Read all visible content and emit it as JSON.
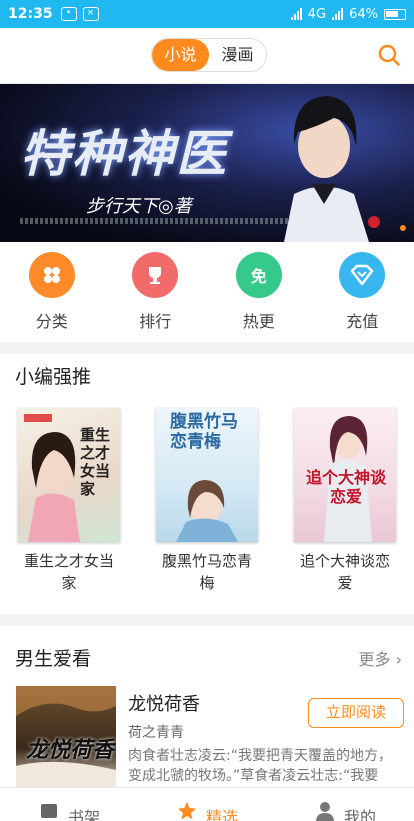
{
  "status": {
    "time": "12:35",
    "network": "4G",
    "battery": "64%"
  },
  "top": {
    "tabs": [
      {
        "label": "小说",
        "active": true
      },
      {
        "label": "漫画",
        "active": false
      }
    ]
  },
  "banner": {
    "title": "特种神医",
    "author": "步行天下◎著"
  },
  "quick": [
    {
      "label": "分类",
      "icon": "grid-icon",
      "color": "#ff8a2a"
    },
    {
      "label": "排行",
      "icon": "trophy-icon",
      "color": "#f26b6b"
    },
    {
      "label": "热更",
      "icon": "free-icon",
      "color": "#35c98a",
      "glyph": "免"
    },
    {
      "label": "充值",
      "icon": "diamond-icon",
      "color": "#38b6ef"
    }
  ],
  "editor": {
    "title": "小编强推",
    "books": [
      {
        "title": "重生之才女当家",
        "cover_text": "重生之才女当家"
      },
      {
        "title": "腹黑竹马恋青梅",
        "cover_text": "腹黑竹马恋青梅"
      },
      {
        "title": "追个大神谈恋爱",
        "cover_text": "追个大神谈恋爱"
      }
    ]
  },
  "boys": {
    "title": "男生爱看",
    "more": "更多",
    "item": {
      "title": "龙悦荷香",
      "author": "荷之青青",
      "desc": "肉食者壮志凌云:“我要把青天覆盖的地方，变成北虢的牧场。”草食者凌云壮志:“我要",
      "button": "立即阅读",
      "cover_text": "龙悦荷香"
    }
  },
  "tabbar": [
    {
      "label": "书架",
      "icon": "bookshelf-icon",
      "active": false
    },
    {
      "label": "精选",
      "icon": "star-icon",
      "active": true
    },
    {
      "label": "我的",
      "icon": "user-icon",
      "active": false
    }
  ],
  "colors": {
    "accent": "#ff8a1e",
    "statusbar": "#20b8f0"
  }
}
